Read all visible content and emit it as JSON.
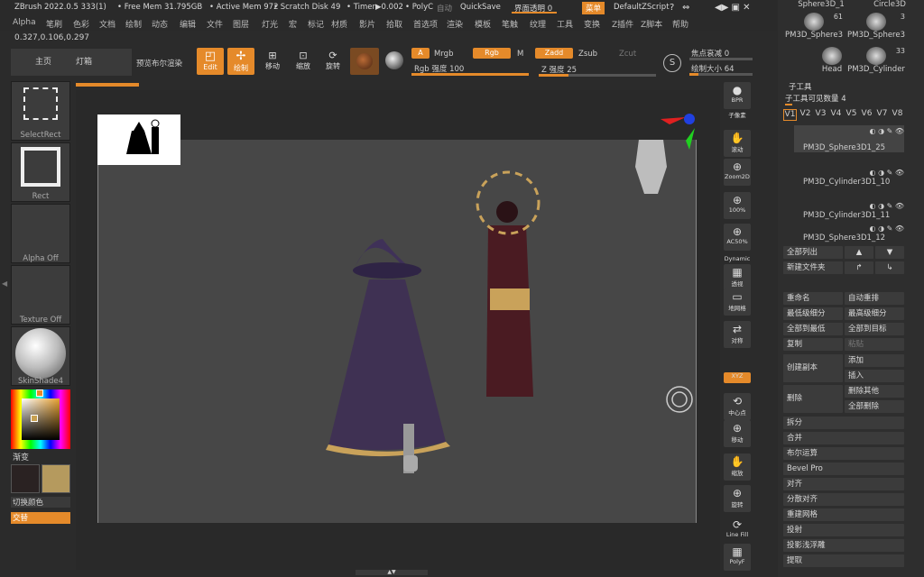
{
  "topbar": {
    "app_version": "ZBrush 2022.0.5 333(1)",
    "free_mem": "• Free Mem 31.795GB",
    "active_mem": "• Active Mem 972",
    "scratch_disk": "• Scratch Disk 49",
    "timer": "• Timer▶0.002",
    "polyc": "• PolyC",
    "auto": "自动",
    "quicksave": "QuickSave",
    "transparency": "界面透明 0",
    "menu_btn": "菜单",
    "default_script": "DefaultZScript"
  },
  "menus": [
    "Alpha",
    "笔刷",
    "色彩",
    "文档",
    "绘制",
    "动态",
    "编辑",
    "文件",
    "图层",
    "灯光",
    "宏",
    "标记",
    "材质",
    "影片",
    "拾取",
    "首选项",
    "渲染",
    "模板",
    "笔触",
    "纹理",
    "工具",
    "变换",
    "Z插件",
    "Z脚本",
    "帮助"
  ],
  "coords": "0.327,0.106,0.297",
  "toolbar": {
    "home": "主页",
    "lightbox": "灯箱",
    "preview_bool": "预览布尔渲染",
    "edit": "Edit",
    "draw": "绘制",
    "move": "移动",
    "scale": "缩放",
    "rotate": "旋转",
    "a_label": "A",
    "mrgb": "Mrgb",
    "rgb": "Rgb",
    "m": "M",
    "zadd": "Zadd",
    "zsub": "Zsub",
    "zcut": "Zcut",
    "rgb_intensity": "Rgb 强度 100",
    "z_intensity": "Z 强度 25",
    "focal_shift": "焦点衰减 0",
    "draw_size": "绘制大小 64"
  },
  "left": {
    "select_rect": "SelectRect",
    "rect": "Rect",
    "alpha_off": "Alpha Off",
    "texture_off": "Texture Off",
    "material": "SkinShade4",
    "gradient": "渐变",
    "switch_color": "切换颜色",
    "alternate": "交替"
  },
  "right_tools": [
    "BPR",
    "子像素",
    "滚动",
    "Zoom2D",
    "100%",
    "AC50%",
    "Dynamic",
    "透视",
    "地网格",
    "对称",
    "XYZ",
    "中心点",
    "移动",
    "缩放",
    "旋转",
    "Line Fill",
    "PolyF"
  ],
  "tool_thumbs": [
    {
      "name": "Sphere3D_1",
      "count": ""
    },
    {
      "name": "Circle3D",
      "count": ""
    },
    {
      "name": "PM3D_Sphere3",
      "count": "61"
    },
    {
      "name": "PM3D_Sphere3",
      "count": "3"
    },
    {
      "name": "Head",
      "count": ""
    },
    {
      "name": "PM3D_Cylinder",
      "count": "33"
    }
  ],
  "subtool": {
    "header": "子工具",
    "visible_count": "子工具可见数量 4",
    "versions": [
      "V1",
      "V2",
      "V3",
      "V4",
      "V5",
      "V6",
      "V7",
      "V8"
    ],
    "items": [
      "PM3D_Sphere3D1_25",
      "PM3D_Cylinder3D1_10",
      "PM3D_Cylinder3D1_11",
      "PM3D_Sphere3D1_12"
    ],
    "list_all": "全部列出",
    "new_folder": "新建文件夹",
    "rename": "重命名",
    "auto_reorder": "自动重排",
    "lowest_sub": "最低级细分",
    "highest_sub": "最高级细分",
    "all_low": "全部到最低",
    "all_high": "全部到目标",
    "copy": "复制",
    "paste": "粘贴",
    "create_copy": "创建副本",
    "add": "添加",
    "insert": "插入",
    "delete": "删除",
    "delete_other": "删除其他",
    "delete_all": "全部删除",
    "split": "拆分",
    "merge": "合并",
    "boolean": "布尔运算",
    "bevel_pro": "Bevel Pro",
    "align": "对齐",
    "distribute": "分散对齐",
    "remesh": "重建网格",
    "project": "投射",
    "project_bas": "投影浅浮雕",
    "extract": "提取"
  },
  "colors": {
    "accent": "#e58a2a",
    "panel": "#2e2e2e",
    "canvas": "#474747"
  }
}
